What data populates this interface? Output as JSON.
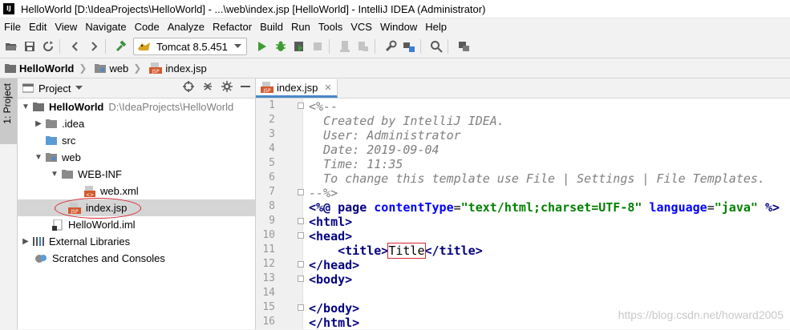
{
  "window": {
    "title": "HelloWorld [D:\\IdeaProjects\\HelloWorld] - ...\\web\\index.jsp [HelloWorld] - IntelliJ IDEA (Administrator)",
    "app_icon_text": "IJ"
  },
  "menu": [
    "File",
    "Edit",
    "View",
    "Navigate",
    "Code",
    "Analyze",
    "Refactor",
    "Build",
    "Run",
    "Tools",
    "VCS",
    "Window",
    "Help"
  ],
  "toolbar": {
    "run_config": "Tomcat 8.5.451"
  },
  "breadcrumb": [
    "HelloWorld",
    "web",
    "index.jsp"
  ],
  "sidebar": {
    "tab_label": "1: Project"
  },
  "project_panel": {
    "title": "Project",
    "tree": [
      {
        "label": "HelloWorld",
        "path": "D:\\IdeaProjects\\HelloWorld"
      },
      {
        "label": ".idea"
      },
      {
        "label": "src"
      },
      {
        "label": "web"
      },
      {
        "label": "WEB-INF"
      },
      {
        "label": "web.xml"
      },
      {
        "label": "index.jsp"
      },
      {
        "label": "HelloWorld.iml"
      },
      {
        "label": "External Libraries"
      },
      {
        "label": "Scratches and Consoles"
      }
    ]
  },
  "editor": {
    "tab_label": "index.jsp",
    "line_numbers": [
      "1",
      "2",
      "3",
      "4",
      "5",
      "6",
      "7",
      "8",
      "9",
      "10",
      "11",
      "12",
      "13",
      "14",
      "15",
      "16"
    ],
    "lines": {
      "l1": "<%--",
      "l2": "  Created by IntelliJ IDEA.",
      "l3": "  User: Administrator",
      "l4": "  Date: 2019-09-04",
      "l5": "  Time: 11:35",
      "l6": "  To change this template use File | Settings | File Templates.",
      "l7": "--%>",
      "l8_open": "<%@ page ",
      "l8_attr1": "contentType",
      "l8_eq1": "=",
      "l8_val1": "\"text/html;charset=UTF-8\"",
      "l8_sp": " ",
      "l8_attr2": "language",
      "l8_eq2": "=",
      "l8_val2": "\"java\"",
      "l8_close": " %>",
      "l9": "<html>",
      "l10": "<head>",
      "l11_indent": "    ",
      "l11_open": "<title>",
      "l11_text": "Title",
      "l11_close": "</title>",
      "l12": "</head>",
      "l13": "<body>",
      "l14": "",
      "l15": "</body>",
      "l16": "</html>"
    }
  },
  "watermark": "https://blog.csdn.net/howard2005"
}
